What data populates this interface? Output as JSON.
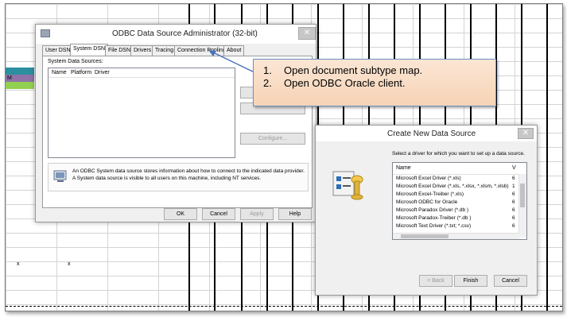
{
  "spreadsheet": {
    "cell_m": "M",
    "cell_x1": "x",
    "cell_x2": "x",
    "accent_teal": "#2c8f9e",
    "accent_purple": "#8e72a8",
    "accent_green": "#92d050"
  },
  "odbc_dialog": {
    "title": "ODBC Data Source Administrator (32-bit)",
    "close_label": "✕",
    "tabs": [
      "User DSN",
      "System DSN",
      "File DSN",
      "Drivers",
      "Tracing",
      "Connection Pooling",
      "About"
    ],
    "active_tab": "System DSN",
    "list_label": "System Data Sources:",
    "columns": [
      "Name",
      "Platform",
      "Driver"
    ],
    "side_buttons": [
      "",
      "",
      "Configure..."
    ],
    "info_text_line1": "An ODBC System data source stores information about how to connect to the indicated data provider.",
    "info_text_line2": "A System data source is visible to all users on this machine, including NT services.",
    "buttons": {
      "ok": "OK",
      "cancel": "Cancel",
      "apply": "Apply",
      "help": "Help"
    },
    "info_icon": "computer-database-icon"
  },
  "callout": {
    "items": [
      {
        "num": "1.",
        "text": "Open document subtype map."
      },
      {
        "num": "2.",
        "text": "Open ODBC Oracle client."
      }
    ]
  },
  "new_ds_dialog": {
    "title": "Create New Data Source",
    "close_label": "✕",
    "prompt": "Select a driver for which you want to set up a data source.",
    "column_name": "Name",
    "column_version": "V",
    "drivers": [
      {
        "name": "Microsoft Excel Driver (*.xls)",
        "v": "6"
      },
      {
        "name": "Microsoft Excel Driver (*.xls, *.xlsx, *.xlsm, *.xlsb)",
        "v": "1"
      },
      {
        "name": "Microsoft Excel-Treiber (*.xls)",
        "v": "6"
      },
      {
        "name": "Microsoft ODBC for Oracle",
        "v": "6"
      },
      {
        "name": "Microsoft Paradox Driver (*.db )",
        "v": "6"
      },
      {
        "name": "Microsoft Paradox-Treiber (*.db )",
        "v": "6"
      },
      {
        "name": "Microsoft Text Driver (*.txt; *.csv)",
        "v": "6"
      }
    ],
    "buttons": {
      "back": "< Back",
      "finish": "Finish",
      "cancel": "Cancel"
    },
    "wizard_icon": "setup-wizard-icon"
  }
}
